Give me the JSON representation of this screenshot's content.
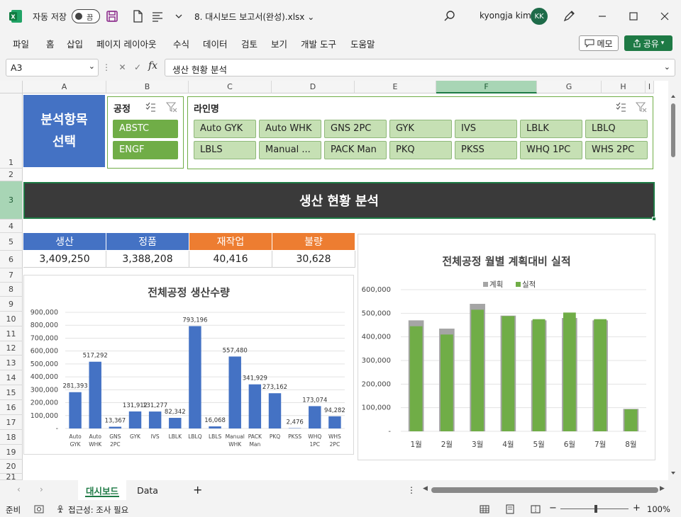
{
  "titlebar": {
    "autosave_label": "자동 저장",
    "autosave_state": "끔",
    "doc_title": "8. 대시보드 보고서(완성).xlsx ⌄",
    "user_name": "kyongja kim",
    "avatar_initials": "KK"
  },
  "menu": {
    "items": [
      "파일",
      "홈",
      "삽입",
      "페이지 레이아웃",
      "수식",
      "데이터",
      "검토",
      "보기",
      "개발 도구",
      "도움말"
    ],
    "memo_label": "메모",
    "share_label": "공유"
  },
  "formula_bar": {
    "cell_ref": "A3",
    "formula": "생산 현황 분석"
  },
  "columns": [
    "A",
    "B",
    "C",
    "D",
    "E",
    "F",
    "G",
    "H",
    "I"
  ],
  "rows": [
    "1",
    "2",
    "3",
    "4",
    "5",
    "6",
    "7",
    "8",
    "9",
    "10",
    "11",
    "12",
    "13",
    "14",
    "15",
    "16",
    "17",
    "18",
    "19",
    "20",
    "21"
  ],
  "selector": {
    "line1": "분석항목",
    "line2": "선택"
  },
  "slicer_process": {
    "title": "공정",
    "items": [
      "ABSTC",
      "ENGF"
    ]
  },
  "slicer_line": {
    "title": "라인명",
    "items": [
      "Auto GYK",
      "Auto WHK",
      "GNS 2PC",
      "GYK",
      "IVS",
      "LBLK",
      "LBLQ",
      "LBLS",
      "Manual ...",
      "PACK Man",
      "PKQ",
      "PKSS",
      "WHQ 1PC",
      "WHS 2PC"
    ]
  },
  "banner_title": "생산 현황 분석",
  "kpis": [
    {
      "label": "생산",
      "value": "3,409,250",
      "color": "#4472c4"
    },
    {
      "label": "정품",
      "value": "3,388,208",
      "color": "#4472c4"
    },
    {
      "label": "재작업",
      "value": "40,416",
      "color": "#ed7d31"
    },
    {
      "label": "불량",
      "value": "30,628",
      "color": "#ed7d31"
    }
  ],
  "chart_data": [
    {
      "type": "bar",
      "title": "전체공정 생산수량",
      "categories": [
        "Auto GYK",
        "Auto WHK",
        "GNS 2PC",
        "GYK",
        "IVS",
        "LBLK",
        "LBLQ",
        "LBLS",
        "Manual WHK",
        "PACK Man",
        "PKQ",
        "PKSS",
        "WHQ 1PC",
        "WHS 2PC"
      ],
      "values": [
        281393,
        517292,
        13367,
        131912,
        131277,
        82342,
        793196,
        16068,
        557480,
        341929,
        273162,
        2476,
        173074,
        94282
      ],
      "value_labels": [
        "281,393",
        "517,292",
        "13,367",
        "131,912",
        "131,277",
        "82,342",
        "793,196",
        "16,068",
        "557,480",
        "341,929",
        "273,162",
        "2,476",
        "173,074",
        "94,282"
      ],
      "y_ticks": [
        "900,000",
        "800,000",
        "700,000",
        "600,000",
        "500,000",
        "400,000",
        "300,000",
        "200,000",
        "100,000",
        "-"
      ],
      "ylim": [
        0,
        900000
      ],
      "color": "#4472c4",
      "grid": true
    },
    {
      "type": "bar",
      "title": "전체공정 월별 계획대비 실적",
      "categories": [
        "1월",
        "2월",
        "3월",
        "4월",
        "5월",
        "6월",
        "7월",
        "8월"
      ],
      "series": [
        {
          "name": "계획",
          "values": [
            470000,
            435000,
            540000,
            490000,
            470000,
            480000,
            470000,
            95000
          ],
          "color": "#a5a5a5"
        },
        {
          "name": "실적",
          "values": [
            445000,
            410000,
            515000,
            488000,
            475000,
            503000,
            475000,
            93000
          ],
          "color": "#70ad47"
        }
      ],
      "y_ticks": [
        "600,000",
        "500,000",
        "400,000",
        "300,000",
        "200,000",
        "100,000",
        "-"
      ],
      "ylim": [
        0,
        600000
      ],
      "legend": "top",
      "grid": true
    }
  ],
  "sheet_tabs": [
    "대시보드",
    "Data"
  ],
  "status": {
    "ready": "준비",
    "accessibility": "접근성: 조사 필요",
    "zoom": "100%"
  },
  "colors": {
    "accent": "#1e7a45",
    "blue": "#4472c4",
    "orange": "#ed7d31",
    "green": "#70ad47",
    "banner": "#3a3a3a"
  }
}
